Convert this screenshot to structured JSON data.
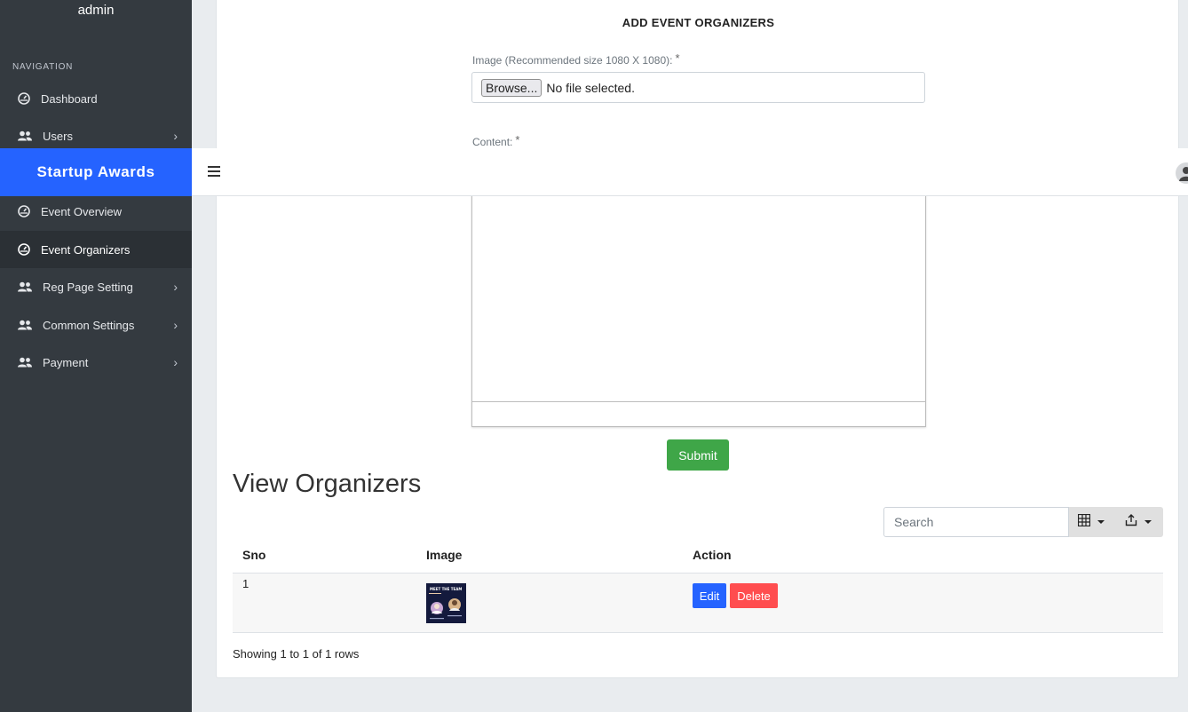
{
  "sidebar": {
    "user_name": "admin",
    "nav_label": "NAVIGATION",
    "items": [
      {
        "label": "Dashboard",
        "icon": "gauge-icon"
      },
      {
        "label": "Users",
        "icon": "users-icon"
      },
      {
        "label": "Event Overview",
        "icon": "gauge-icon"
      },
      {
        "label": "Event Organizers",
        "icon": "gauge-icon"
      },
      {
        "label": "Reg Page Setting",
        "icon": "users-icon"
      },
      {
        "label": "Common Settings",
        "icon": "users-icon"
      },
      {
        "label": "Payment",
        "icon": "users-icon"
      }
    ]
  },
  "brand": {
    "name": "Startup Awards",
    "color": "#2563ff"
  },
  "form": {
    "title": "ADD EVENT ORGANIZERS",
    "image_label": "Image (Recommended size 1080 X 1080):",
    "required_mark": "*",
    "browse_label": "Browse...",
    "file_status": "No file selected.",
    "content_label": "Content:",
    "submit_label": "Submit"
  },
  "table": {
    "title": "View Organizers",
    "search_placeholder": "Search",
    "columns": [
      "Sno",
      "Image",
      "Action"
    ],
    "rows": [
      {
        "sno": "1",
        "image_caption": "MEET THE TEAM",
        "edit_label": "Edit",
        "delete_label": "Delete"
      }
    ],
    "pagination_info": "Showing 1 to 1 of 1 rows"
  },
  "colors": {
    "sidebar_bg": "#343a40",
    "submit": "#3fa648",
    "edit": "#2563ff",
    "delete": "#ff4d4f"
  }
}
